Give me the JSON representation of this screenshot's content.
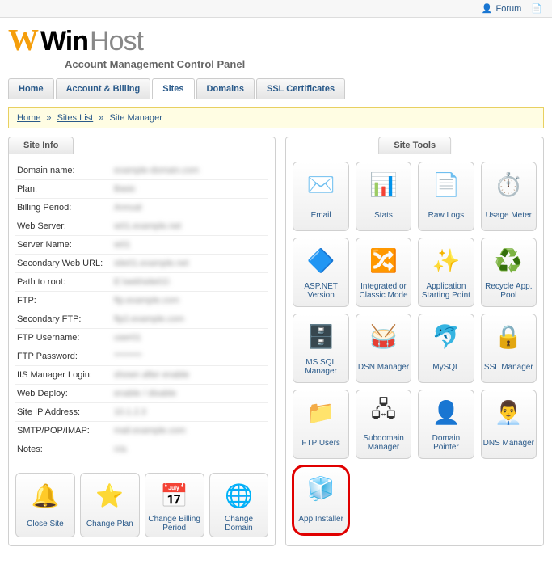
{
  "topbar": {
    "forum": "Forum"
  },
  "brand": {
    "win": "Win",
    "host": "Host",
    "subtitle": "Account Management Control Panel"
  },
  "tabs": [
    {
      "label": "Home"
    },
    {
      "label": "Account & Billing"
    },
    {
      "label": "Sites",
      "active": true
    },
    {
      "label": "Domains"
    },
    {
      "label": "SSL Certificates"
    }
  ],
  "breadcrumb": {
    "home": "Home",
    "sites_list": "Sites List",
    "current": "Site Manager"
  },
  "site_info": {
    "title": "Site Info",
    "rows": [
      {
        "label": "Domain name:",
        "value": "example-domain.com"
      },
      {
        "label": "Plan:",
        "value": "Basic"
      },
      {
        "label": "Billing Period:",
        "value": "Annual"
      },
      {
        "label": "Web Server:",
        "value": "w01.example.net"
      },
      {
        "label": "Server Name:",
        "value": "w01"
      },
      {
        "label": "Secondary Web URL:",
        "value": "site01.example.net"
      },
      {
        "label": "Path to root:",
        "value": "E:\\web\\site01\\"
      },
      {
        "label": "FTP:",
        "value": "ftp.example.com"
      },
      {
        "label": "Secondary FTP:",
        "value": "ftp2.example.com"
      },
      {
        "label": "FTP Username:",
        "value": "user01"
      },
      {
        "label": "FTP Password:",
        "value": "********"
      },
      {
        "label": "IIS Manager Login:",
        "value": "shown after enable"
      },
      {
        "label": "Web Deploy:",
        "value": "enable / disable"
      },
      {
        "label": "Site IP Address:",
        "value": "10.1.2.3"
      },
      {
        "label": "SMTP/POP/IMAP:",
        "value": "mail.example.com"
      },
      {
        "label": "Notes:",
        "value": "n/a"
      }
    ],
    "actions": {
      "close_site": "Close Site",
      "change_plan": "Change Plan",
      "change_billing": "Change Billing Period",
      "change_domain": "Change Domain"
    }
  },
  "site_tools": {
    "title": "Site Tools",
    "items": [
      {
        "label": "Email"
      },
      {
        "label": "Stats"
      },
      {
        "label": "Raw Logs"
      },
      {
        "label": "Usage Meter"
      },
      {
        "label": "ASP.NET Version"
      },
      {
        "label": "Integrated or Classic Mode"
      },
      {
        "label": "Application Starting Point"
      },
      {
        "label": "Recycle App. Pool"
      },
      {
        "label": "MS SQL Manager"
      },
      {
        "label": "DSN Manager"
      },
      {
        "label": "MySQL"
      },
      {
        "label": "SSL Manager"
      },
      {
        "label": "FTP Users"
      },
      {
        "label": "Subdomain Manager"
      },
      {
        "label": "Domain Pointer"
      },
      {
        "label": "DNS Manager"
      },
      {
        "label": "App Installer",
        "highlight": true
      }
    ]
  }
}
